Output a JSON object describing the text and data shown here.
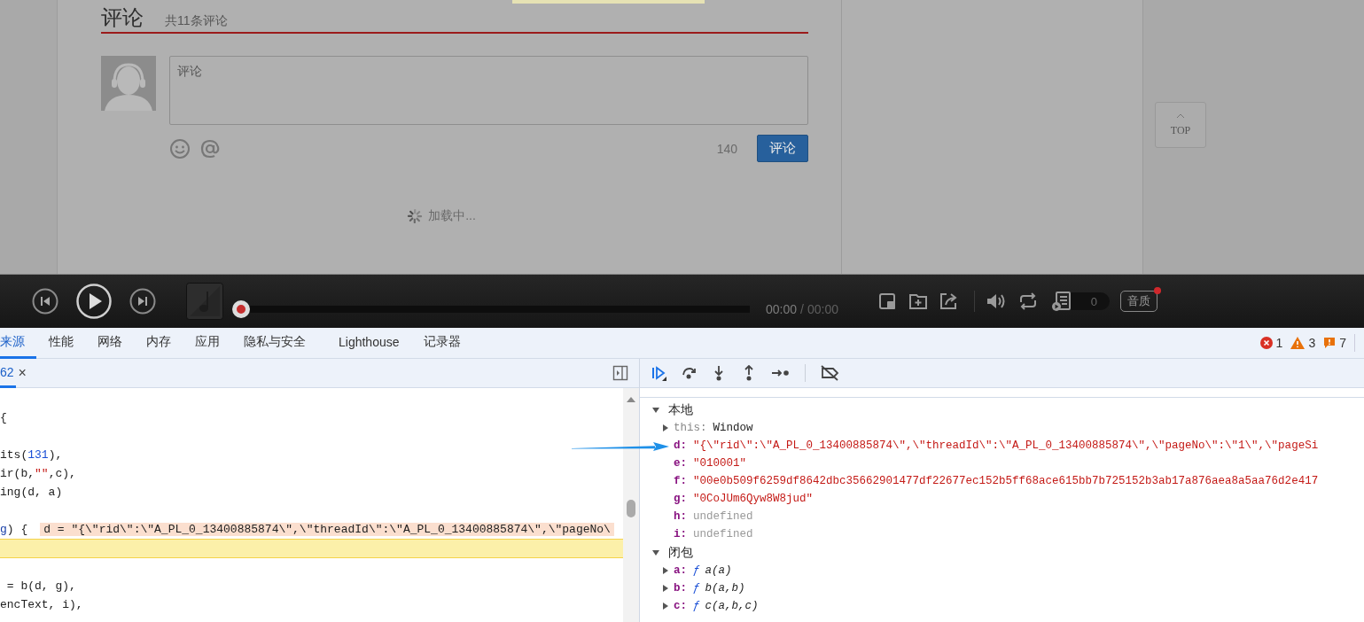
{
  "page": {
    "comments": {
      "title": "评论",
      "count": "共11条评论",
      "placeholder": "评论",
      "char_count": "140",
      "submit": "评论",
      "loading": "加载中..."
    },
    "top_button": "TOP"
  },
  "player": {
    "progress": {
      "level": 0
    },
    "time_current": "00:00",
    "time_separator": "/",
    "time_total": "00:00",
    "playlist_count": "0",
    "quality": "音质",
    "quality_badge": true
  },
  "devtools": {
    "tabs": [
      {
        "label": "来源",
        "selected": true
      },
      {
        "label": "性能",
        "selected": false
      },
      {
        "label": "网络",
        "selected": false
      },
      {
        "label": "内存",
        "selected": false
      },
      {
        "label": "应用",
        "selected": false
      },
      {
        "label": "隐私与安全",
        "selected": false
      },
      {
        "label": "Lighthouse",
        "selected": false
      },
      {
        "label": "记录器",
        "selected": false
      }
    ],
    "issues": [
      {
        "kind": "error",
        "count": "1"
      },
      {
        "kind": "warning",
        "count": "3"
      },
      {
        "kind": "info",
        "count": "7"
      }
    ],
    "file_tab": {
      "label": "62",
      "close": "×"
    },
    "code_lines": [
      {
        "current": false
      },
      {
        "current": false,
        "segments": [
          {
            "kind": "plain",
            "text": "{"
          }
        ]
      },
      {
        "current": false
      },
      {
        "current": false,
        "segments": [
          {
            "kind": "plain",
            "text": "its("
          },
          {
            "kind": "number",
            "text": "131"
          },
          {
            "kind": "plain",
            "text": "),"
          }
        ]
      },
      {
        "current": false,
        "segments": [
          {
            "kind": "plain",
            "text": "ir(b,"
          },
          {
            "kind": "string",
            "text": "\"\""
          },
          {
            "kind": "plain",
            "text": ",c),"
          }
        ]
      },
      {
        "current": false,
        "segments": [
          {
            "kind": "plain",
            "text": "ing(d, a)"
          }
        ]
      },
      {
        "current": false
      },
      {
        "current": false,
        "segments": [
          {
            "kind": "param",
            "text": "g"
          },
          {
            "kind": "plain",
            "text": ") {"
          },
          {
            "kind": "inline",
            "text": "d = \"{\\\"rid\\\":\\\"A_PL_0_13400885874\\\",\\\"threadId\\\":\\\"A_PL_0_13400885874\\\",\\\"pageNo\\"
          }
        ]
      },
      {
        "current": true
      },
      {
        "current": false
      },
      {
        "current": false,
        "segments": [
          {
            "kind": "plain",
            "text": " = b(d, g),"
          }
        ]
      },
      {
        "current": false,
        "segments": [
          {
            "kind": "plain",
            "text": "encText, i),"
          }
        ]
      }
    ],
    "scope": [
      {
        "label": "本地",
        "expanded": true,
        "vars": [
          {
            "name": "this:",
            "kind": "object",
            "value": "Window",
            "expandable": true
          },
          {
            "name": "d:",
            "kind": "string",
            "value": "\"{\\\"rid\\\":\\\"A_PL_0_13400885874\\\",\\\"threadId\\\":\\\"A_PL_0_13400885874\\\",\\\"pageNo\\\":\\\"1\\\",\\\"pageSi",
            "expandable": false
          },
          {
            "name": "e:",
            "kind": "string",
            "value": "\"010001\"",
            "expandable": false
          },
          {
            "name": "f:",
            "kind": "string",
            "value": "\"00e0b509f6259df8642dbc35662901477df22677ec152b5ff68ace615bb7b725152b3ab17a876aea8a5aa76d2e417",
            "expandable": false
          },
          {
            "name": "g:",
            "kind": "string",
            "value": "\"0CoJUm6Qyw8W8jud\"",
            "expandable": false
          },
          {
            "name": "h:",
            "kind": "undefined",
            "value": "undefined",
            "expandable": false
          },
          {
            "name": "i:",
            "kind": "undefined",
            "value": "undefined",
            "expandable": false
          }
        ]
      },
      {
        "label": "闭包",
        "expanded": true,
        "vars": [
          {
            "name": "a:",
            "kind": "function",
            "marker": "ƒ",
            "value": "a(a)",
            "expandable": true
          },
          {
            "name": "b:",
            "kind": "function",
            "marker": "ƒ",
            "value": "b(a,b)",
            "expandable": true
          },
          {
            "name": "c:",
            "kind": "function",
            "marker": "ƒ",
            "value": "c(a,b,c)",
            "expandable": true
          }
        ]
      }
    ]
  }
}
